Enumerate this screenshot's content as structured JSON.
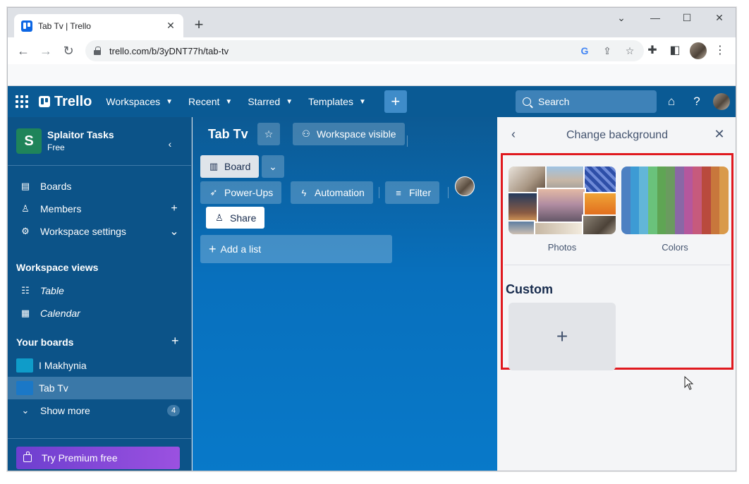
{
  "browser": {
    "tab_title": "Tab Tv | Trello",
    "url": "trello.com/b/3yDNT77h/tab-tv"
  },
  "header": {
    "logo": "Trello",
    "nav": [
      "Workspaces",
      "Recent",
      "Starred",
      "Templates"
    ],
    "search_label": "Search"
  },
  "sidebar": {
    "workspace_initial": "S",
    "workspace_name": "Splaitor Tasks",
    "workspace_plan": "Free",
    "items": [
      {
        "label": "Boards",
        "icon": "board-icon"
      },
      {
        "label": "Members",
        "icon": "person-icon"
      },
      {
        "label": "Workspace settings",
        "icon": "gear-icon"
      }
    ],
    "views_heading": "Workspace views",
    "views": [
      {
        "label": "Table",
        "icon": "table-icon"
      },
      {
        "label": "Calendar",
        "icon": "calendar-icon"
      }
    ],
    "boards_heading": "Your boards",
    "boards": [
      {
        "label": "I Makhynia",
        "color": "#0f9cc9"
      },
      {
        "label": "Tab Tv",
        "color": "#1b78c7"
      }
    ],
    "show_more": "Show more",
    "show_more_count": "4",
    "premium": "Try Premium free"
  },
  "board": {
    "title": "Tab Tv",
    "visibility": "Workspace visible",
    "view": "Board",
    "power_ups": "Power-Ups",
    "automation": "Automation",
    "filter": "Filter",
    "share": "Share",
    "add_list": "Add a list"
  },
  "panel": {
    "title": "Change background",
    "photos_label": "Photos",
    "colors_label": "Colors",
    "custom_heading": "Custom",
    "color_swatches": [
      "#4d80c2",
      "#3d9bd4",
      "#62b6d8",
      "#6ac27b",
      "#5fa554",
      "#6a9b5f",
      "#8a67a6",
      "#b5579d",
      "#c65a7d",
      "#b94a3d",
      "#c8773c",
      "#d99a4a"
    ]
  },
  "colors": {
    "header": "#0a5a94",
    "sidebar": "#0c5388",
    "highlight": "#e0191f"
  }
}
